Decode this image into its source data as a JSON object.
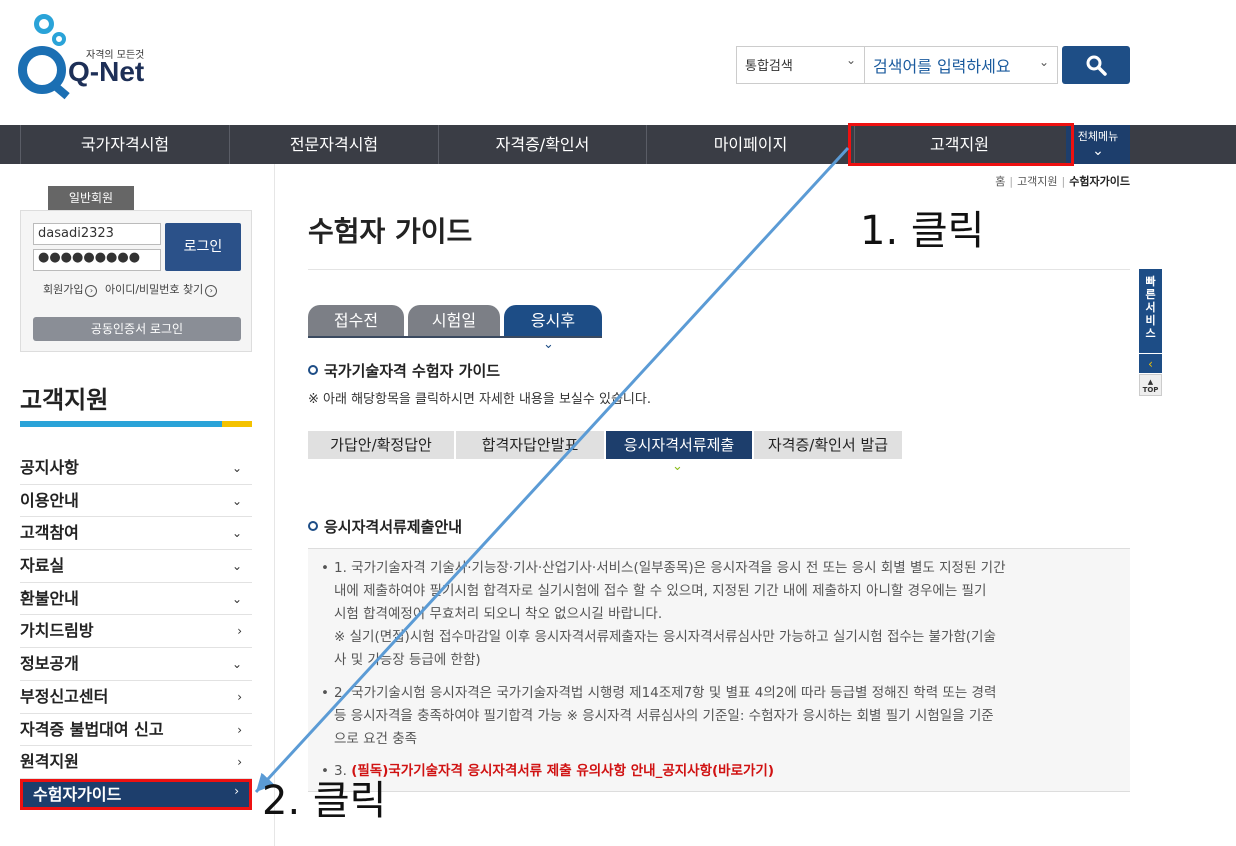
{
  "header": {
    "logo_tagline": "자격의 모든것",
    "logo_word": "Q-Net",
    "search_scope": "통합검색",
    "search_placeholder": "검색어를 입력하세요"
  },
  "gnb": {
    "items": [
      "국가자격시험",
      "전문자격시험",
      "자격증/확인서",
      "마이페이지",
      "고객지원"
    ],
    "all_menu": "전체메뉴"
  },
  "breadcrumb": [
    "홈",
    "고객지원",
    "수험자가이드"
  ],
  "login": {
    "member_tab": "일반회원",
    "id_value": "dasadi2323",
    "password_mask": "●●●●●●●●●",
    "login_button": "로그인",
    "join_link": "회원가입",
    "find_link": "아이디/비밀번호 찾기",
    "cert_login": "공동인증서 로그인"
  },
  "sidebar": {
    "title": "고객지원",
    "items": [
      {
        "label": "공지사항",
        "arrow": "⌄"
      },
      {
        "label": "이용안내",
        "arrow": "⌄"
      },
      {
        "label": "고객참여",
        "arrow": "⌄"
      },
      {
        "label": "자료실",
        "arrow": "⌄"
      },
      {
        "label": "환불안내",
        "arrow": "⌄"
      },
      {
        "label": "가치드림방",
        "arrow": "›"
      },
      {
        "label": "정보공개",
        "arrow": "⌄"
      },
      {
        "label": "부정신고센터",
        "arrow": "›"
      },
      {
        "label": "자격증 불법대여 신고",
        "arrow": "›"
      },
      {
        "label": "원격지원",
        "arrow": "›"
      },
      {
        "label": "수험자가이드",
        "arrow": "›"
      }
    ]
  },
  "main": {
    "title": "수험자 가이드",
    "stage_tabs": [
      "접수전",
      "시험일",
      "응시후"
    ],
    "section1_title": "국가기술자격 수험자 가이드",
    "section1_note": "※ 아래 해당항목을 클릭하시면 자세한 내용을 보실수 있습니다.",
    "sub_tabs": [
      "가답안/확정답안",
      "합격자답안발표",
      "응시자격서류제출",
      "자격증/확인서 발급"
    ],
    "section2_title": "응시자격서류제출안내",
    "notice": {
      "p1_line1": "1. 국가기술자격 기술사·기능장·기사·산업기사·서비스(일부종목)은 응시자격을 응시 전 또는 응시 회별 별도 지정된 기간",
      "p1_line2": "내에 제출하여야 필기시험 합격자로 실기시험에 접수 할 수 있으며, 지정된 기간 내에 제출하지 아니할 경우에는 필기",
      "p1_line3": "시험 합격예정이 무효처리 되오니 착오 없으시길 바랍니다.",
      "p1_line4": "※ 실기(면접)시험 접수마감일 이후 응시자격서류제출자는 응시자격서류심사만 가능하고 실기시험 접수는 불가함(기술",
      "p1_line5": "사 및 기능장 등급에 한함)",
      "p2_line1": "2. 국가기술시험 응시자격은 국가기술자격법 시행령 제14조제7항 및 별표 4의2에 따라 등급별 정해진 학력 또는 경력",
      "p2_line2": "등 응시자격을 충족하여야 필기합격 가능 ※ 응시자격 서류심사의 기준일: 수험자가 응시하는 회별 필기 시험일을 기준",
      "p2_line3": "으로 요건 충족",
      "p3_num": "3.",
      "p3_link": "(필독)국가기술자격 응시자격서류 제출 유의사항 안내_공지사항(바로가기)"
    }
  },
  "quick_service": {
    "label_chars": [
      "빠",
      "른",
      "서",
      "비",
      "스"
    ],
    "top_label": "TOP"
  },
  "annotations": {
    "step1": "1. 클릭",
    "step2": "2. 클릭",
    "color": "#e11111",
    "arrow_color": "#5b9bd5"
  }
}
